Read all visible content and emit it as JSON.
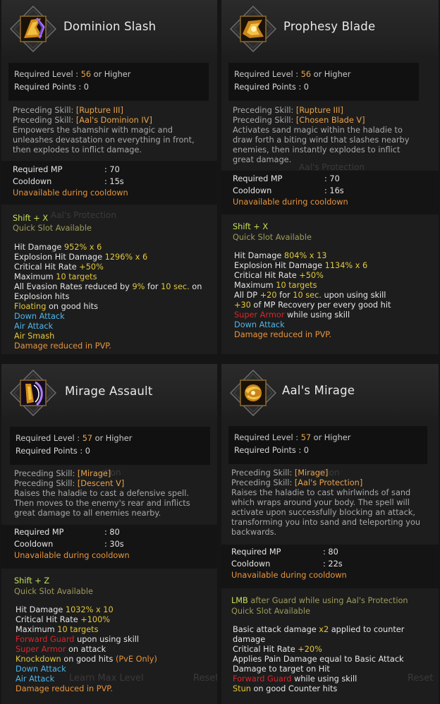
{
  "panels": [
    {
      "title": "Dominion Slash",
      "icon": "sword-slash-icon",
      "req_level_label": "Required Level : ",
      "req_level": "56",
      "req_level_suffix": " or Higher",
      "req_points": "Required Points : 0",
      "preceding_label": "Preceding Skill: ",
      "preceding_1": "[Rupture III]",
      "preceding_2": "[Aal's Dominion IV]",
      "description": [
        "Empowers the shamshir with magic and",
        "unleashes devastation on everything in front,",
        "then explodes to inflict damage."
      ],
      "mp_label": "Required MP",
      "mp_value": ": 70",
      "cd_label": "Cooldown",
      "cd_value": ": 15s",
      "cd_note": "Unavailable during cooldown",
      "hotkey": "Shift + X",
      "quickslot": "Quick Slot Available",
      "ghost": "Aal's Protection"
    },
    {
      "title": "Prophesy Blade",
      "icon": "blade-prophecy-icon",
      "req_level_label": "Required Level : ",
      "req_level": "56",
      "req_level_suffix": " or Higher",
      "req_points": "Required Points : 0",
      "preceding_label": "Preceding Skill: ",
      "preceding_1": "[Rupture III]",
      "preceding_2": "[Chosen Blade V]",
      "description": [
        "Activates sand magic within the haladie to",
        "draw forth a biting wind that slashes nearby",
        "enemies, then instantly explodes to inflict",
        "great damage."
      ],
      "mp_label": "Required MP",
      "mp_value": ": 70",
      "cd_label": "Cooldown",
      "cd_value": ": 16s",
      "cd_note": "Unavailable during cooldown",
      "hotkey": "Shift + X",
      "quickslot": "Quick Slot Available",
      "ghost": "Aal's Protection"
    },
    {
      "title": "Mirage Assault",
      "icon": "mirage-assault-icon",
      "req_level_label": "Required Level : ",
      "req_level": "57",
      "req_level_suffix": " or Higher",
      "req_points": "Required Points : 0",
      "preceding_label": "Preceding Skill: ",
      "preceding_1": "[Mirage]",
      "preceding_2": "[Descent V]",
      "description": [
        "Raises the haladie to cast a defensive spell.",
        "Then moves to the enemy's rear and inflicts",
        "great damage to all enemies nearby."
      ],
      "mp_label": "Required MP",
      "mp_value": ": 80",
      "cd_label": "Cooldown",
      "cd_value": ": 30s",
      "cd_note": "Unavailable during cooldown",
      "hotkey": "Shift + Z",
      "quickslot": "Quick Slot Available",
      "ghost": "ction"
    },
    {
      "title": "Aal's Mirage",
      "icon": "sand-mirage-icon",
      "req_level_label": "Required Level : ",
      "req_level": "57",
      "req_level_suffix": " or Higher",
      "req_points": "Required Points : 0",
      "preceding_label": "Preceding Skill: ",
      "preceding_1": "[Mirage]",
      "preceding_2": "[Aal's Protection]",
      "description": [
        "Raises the haladie to cast whirlwinds of sand",
        "which wraps around your body. The spell will",
        "activate upon successfully blocking an attack,",
        "transforming you into sand and teleporting you",
        "backwards."
      ],
      "mp_label": "Required MP",
      "mp_value": ": 80",
      "cd_label": "Cooldown",
      "cd_value": ": 22s",
      "cd_note": "Unavailable during cooldown",
      "hotkey": "LMB",
      "hotkey_suffix": " after Guard while using Aal's Protection",
      "quickslot": "Quick Slot Available",
      "ghost": "ction"
    }
  ],
  "effects": {
    "p1": {
      "hit_label": "Hit Damage ",
      "hit_val": "952% x 6",
      "exp_label": "Explosion Hit Damage ",
      "exp_val": "1296% x 6",
      "crit_label": "Critical Hit Rate ",
      "crit_val": "+50%",
      "max_label": "Maximum ",
      "max_val": "10 targets",
      "eva_a": "All Evasion Rates reduced by ",
      "eva_b": "9%",
      "eva_c": " for ",
      "eva_d": "10 sec.",
      "eva_e": " on",
      "eva_2": "Explosion hits",
      "float_a": "Floating",
      "float_b": " on good hits",
      "down": "Down Attack",
      "air": "Air Attack",
      "smash": "Air Smash",
      "pvp": "Damage reduced in PVP."
    },
    "p2": {
      "hit_label": "Hit Damage ",
      "hit_val": "804% x 13",
      "exp_label": "Explosion Hit Damage ",
      "exp_val": "1134% x 6",
      "crit_label": "Critical Hit Rate ",
      "crit_val": "+50%",
      "max_label": "Maximum ",
      "max_val": "10 targets",
      "dp_a": "All DP ",
      "dp_b": "+20",
      "dp_c": " for ",
      "dp_d": "10 sec.",
      "dp_e": " upon using skill",
      "mp_a": "+30",
      "mp_b": " of MP Recovery per every good hit",
      "sa_a": "Super Armor",
      "sa_b": " while using skill",
      "down": "Down Attack",
      "pvp": "Damage reduced in PVP."
    },
    "p3": {
      "hit_label": "Hit Damage ",
      "hit_val": "1032% x 10",
      "crit_label": "Critical Hit Rate ",
      "crit_val": "+100%",
      "max_label": "Maximum ",
      "max_val": "10 targets",
      "fg_a": "Forward Guard",
      "fg_b": " upon using skill",
      "sa_a": "Super Armor",
      "sa_b": " on attack",
      "kd_a": "Knockdown",
      "kd_b": " on good hits ",
      "kd_c": "(PvE Only)",
      "down": "Down Attack",
      "air": "Air Attack",
      "pvp": "Damage reduced in PVP."
    },
    "p4": {
      "ba_a": "Basic attack damage ",
      "ba_b": "x2",
      "ba_c": " applied to counter",
      "ba_2": "damage",
      "crit_label": "Critical Hit Rate ",
      "crit_val": "+20%",
      "pain": "Applies Pain Damage equal to Basic Attack",
      "pain_2": "Damage to target on Hit",
      "fg_a": "Forward Guard",
      "fg_b": " while using skill",
      "stun_a": "Stun",
      "stun_b": " on good Counter hits"
    }
  },
  "background_ghosts": {
    "learn": "Learn Max Level",
    "reset": "Reset"
  },
  "colors": {
    "panel_bg": "#1d1d1d",
    "accent_orange": "#e8a34c",
    "hotkey_lime": "#c7e05a",
    "cc_blue": "#4fb6e8",
    "cc_red": "#d8262c"
  }
}
